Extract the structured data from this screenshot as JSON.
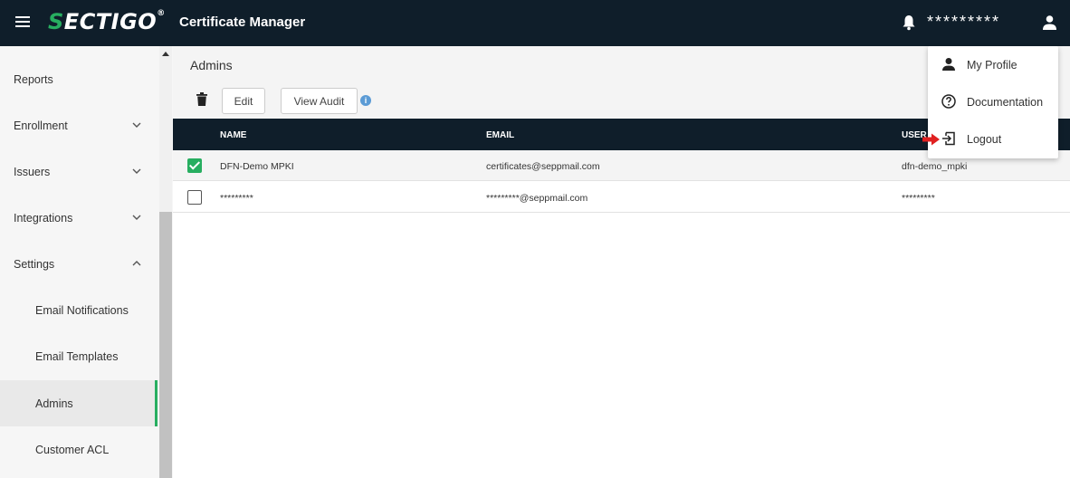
{
  "header": {
    "logo_text": "SECTIGO",
    "logo_mark": "®",
    "app_title": "Certificate Manager",
    "username": "*********"
  },
  "sidebar": {
    "items": [
      {
        "label": "Reports",
        "expandable": false
      },
      {
        "label": "Enrollment",
        "expandable": true,
        "expanded": false
      },
      {
        "label": "Issuers",
        "expandable": true,
        "expanded": false
      },
      {
        "label": "Integrations",
        "expandable": true,
        "expanded": false
      },
      {
        "label": "Settings",
        "expandable": true,
        "expanded": true
      },
      {
        "label": "Email Notifications",
        "sub": true
      },
      {
        "label": "Email Templates",
        "sub": true
      },
      {
        "label": "Admins",
        "sub": true,
        "active": true
      },
      {
        "label": "Customer ACL",
        "sub": true
      }
    ]
  },
  "main": {
    "title": "Admins",
    "toolbar": {
      "edit_label": "Edit",
      "view_audit_label": "View Audit",
      "info_icon": "i"
    },
    "table": {
      "columns": [
        "NAME",
        "EMAIL",
        "USER"
      ],
      "rows": [
        {
          "selected": true,
          "name": "DFN-Demo MPKI",
          "email": "certificates@seppmail.com",
          "username": "dfn-demo_mpki"
        },
        {
          "selected": false,
          "name": "*********",
          "email": "*********@seppmail.com",
          "username": "*********"
        }
      ]
    }
  },
  "user_menu": {
    "items": [
      {
        "label": "My Profile",
        "icon": "person-icon"
      },
      {
        "label": "Documentation",
        "icon": "help-circle-icon"
      },
      {
        "label": "Logout",
        "icon": "logout-icon"
      }
    ]
  },
  "colors": {
    "topbar": "#0f1e2a",
    "accent_green": "#27ae60",
    "pointer_arrow": "#e02020"
  }
}
